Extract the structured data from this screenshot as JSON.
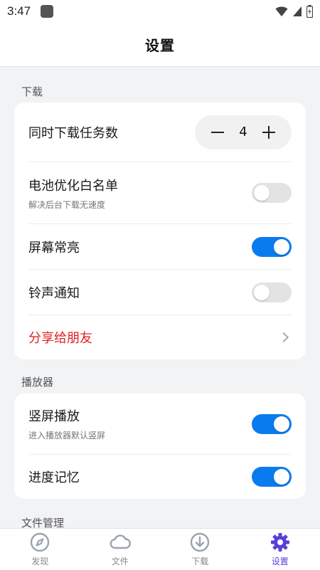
{
  "status_bar": {
    "time": "3:47"
  },
  "header": {
    "title": "设置"
  },
  "sections": {
    "download": {
      "label": "下载",
      "concurrent": {
        "label": "同时下载任务数",
        "value": "4"
      },
      "battery": {
        "label": "电池优化白名单",
        "sub": "解决后台下载无速度",
        "on": false
      },
      "screen": {
        "label": "屏幕常亮",
        "on": true
      },
      "ringtone": {
        "label": "铃声通知",
        "on": false
      },
      "share": {
        "label": "分享给朋友"
      }
    },
    "player": {
      "label": "播放器",
      "portrait": {
        "label": "竖屏播放",
        "sub": "进入播放器默认竖屏",
        "on": true
      },
      "progress": {
        "label": "进度记忆",
        "on": true
      }
    },
    "files": {
      "label": "文件管理"
    }
  },
  "tabs": [
    {
      "label": "发现",
      "icon": "compass-icon"
    },
    {
      "label": "文件",
      "icon": "cloud-icon"
    },
    {
      "label": "下载",
      "icon": "download-icon"
    },
    {
      "label": "设置",
      "icon": "gear-icon"
    }
  ],
  "colors": {
    "accent": "#0a7bef",
    "tab_active": "#5b3fd8",
    "danger": "#e02020"
  }
}
